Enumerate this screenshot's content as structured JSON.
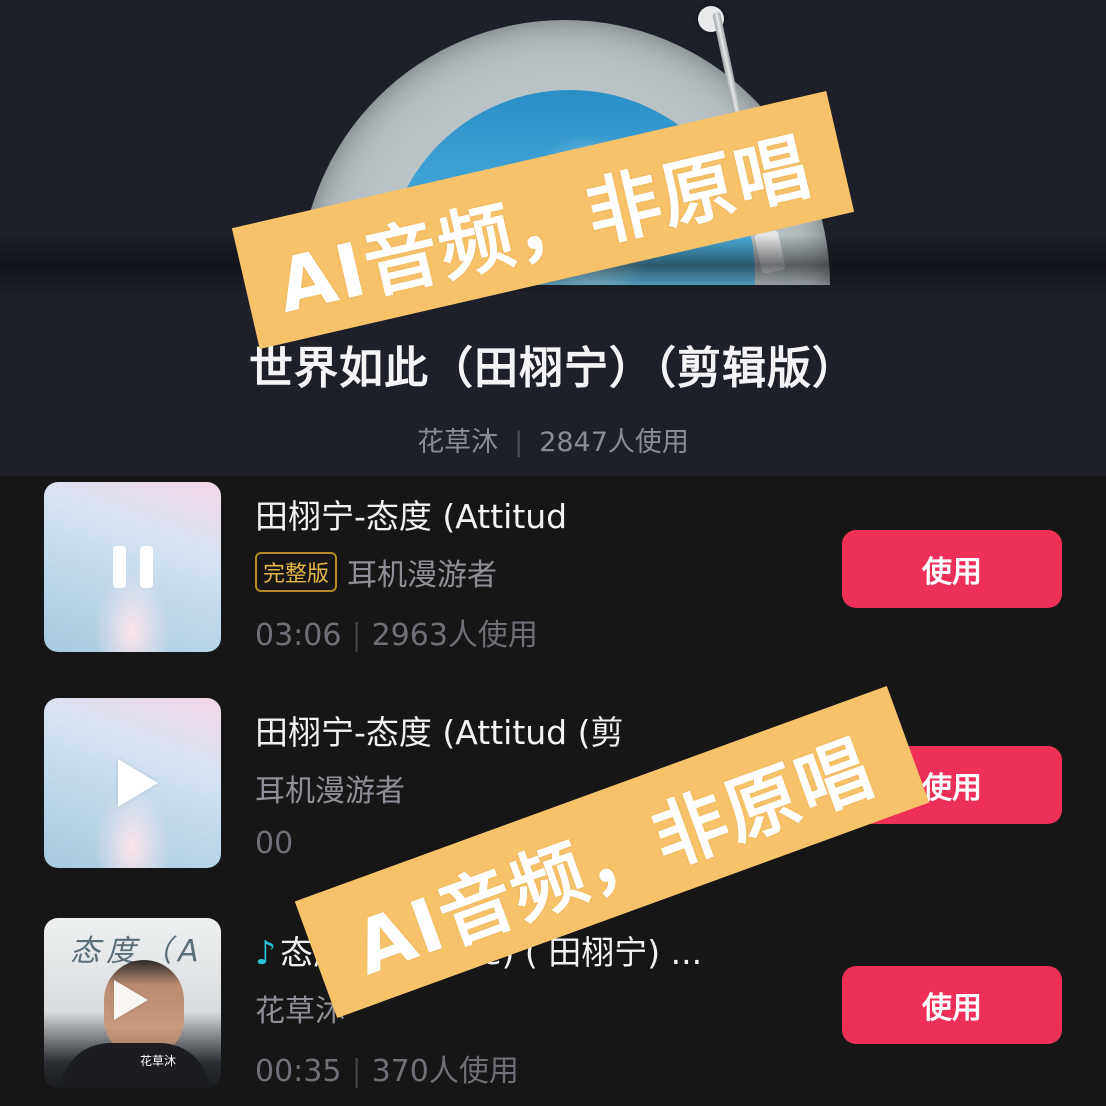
{
  "header": {
    "song_title": "世界如此（田栩宁）（剪辑版）",
    "author": "花草沐",
    "usage": "2847人使用"
  },
  "watermark": {
    "text": "AI音频，非原唱"
  },
  "list": {
    "items": [
      {
        "title": "田栩宁-态度 (Attitud",
        "badge": "完整版",
        "author": "耳机漫游者",
        "duration": "03:06",
        "usage": "2963人使用",
        "button": "使用",
        "state": "playing"
      },
      {
        "title": "田栩宁-态度 (Attitud (剪",
        "author": "耳机漫游者",
        "duration": "00",
        "button": "使用",
        "state": "paused"
      },
      {
        "title": "态度 (Attitude) ( 田栩宁) ...",
        "author": "花草沐",
        "duration": "00:35",
        "usage": "370人使用",
        "button": "使用",
        "cover_text": "态度（A",
        "cover_tag": "花草沐",
        "state": "paused"
      }
    ]
  },
  "colors": {
    "accent": "#ee2f57",
    "badge": "#e6b54a",
    "note_icon": "#29c2d8",
    "watermark_bg": "#f7c26a"
  },
  "icons": [
    "music-disc-icon",
    "tonearm-icon",
    "pause-icon",
    "play-icon",
    "music-note-icon"
  ]
}
